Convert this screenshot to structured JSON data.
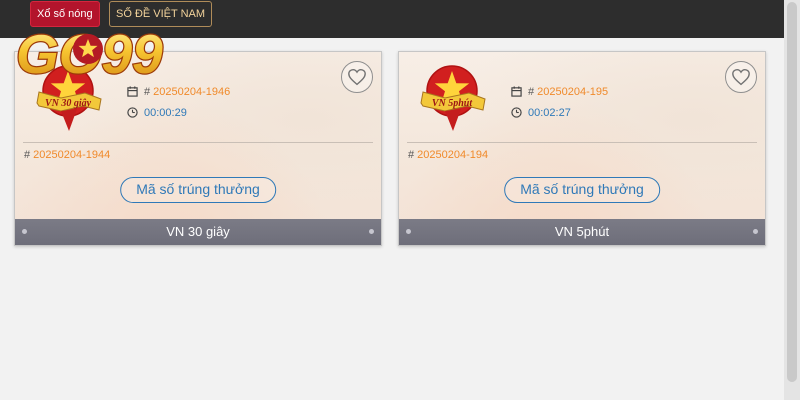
{
  "topnav": {
    "tab_hot": "Xổ số nóng",
    "tab_vn": "SỐ ĐỀ VIỆT NAM"
  },
  "logo": {
    "text": "GO99"
  },
  "cards": [
    {
      "badge_text": "VN 30 giây",
      "current_issue_prefix": "#",
      "current_issue": "20250204-1946",
      "countdown": "00:00:29",
      "previous_issue_prefix": "#",
      "previous_issue": "20250204-1944",
      "winning_button": "Mã số trúng thưởng",
      "footer_title": "VN 30 giây"
    },
    {
      "badge_text": "VN 5phút",
      "current_issue_prefix": "#",
      "current_issue": "20250204-195",
      "countdown": "00:02:27",
      "previous_issue_prefix": "#",
      "previous_issue": "20250204-194",
      "winning_button": "Mã số trúng thưởng",
      "footer_title": "VN 5phút"
    }
  ],
  "icons": {
    "favorite": "heart-outline-icon",
    "calendar": "calendar-icon",
    "clock": "clock-icon",
    "flag_emblem": "vietnam-star-emblem"
  },
  "colors": {
    "topbar": "#2d2d2d",
    "active_tab": "#b3142c",
    "issue_orange": "#f08a2b",
    "timer_blue": "#2f79b8",
    "card_footer": "#74747f"
  }
}
